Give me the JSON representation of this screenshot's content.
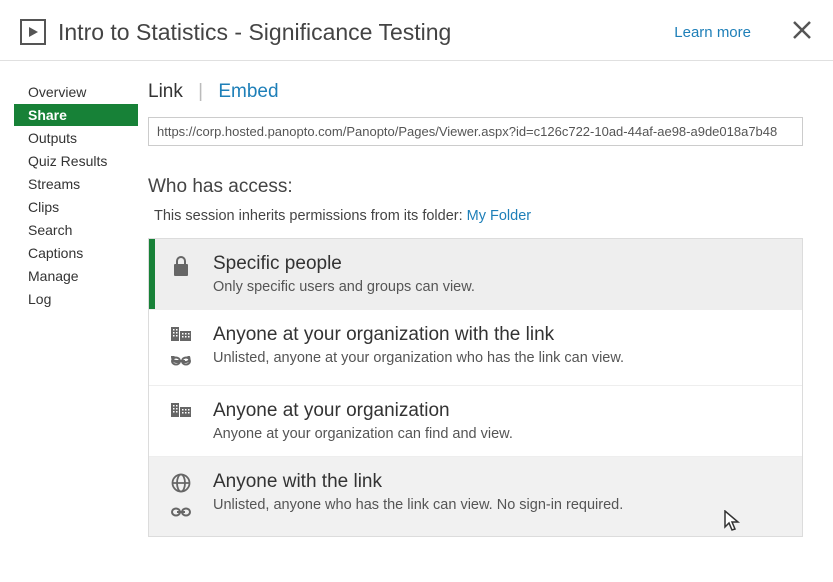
{
  "header": {
    "title": "Intro to Statistics - Significance Testing",
    "learn_more": "Learn more"
  },
  "sidebar": {
    "items": [
      {
        "label": "Overview"
      },
      {
        "label": "Share"
      },
      {
        "label": "Outputs"
      },
      {
        "label": "Quiz Results"
      },
      {
        "label": "Streams"
      },
      {
        "label": "Clips"
      },
      {
        "label": "Search"
      },
      {
        "label": "Captions"
      },
      {
        "label": "Manage"
      },
      {
        "label": "Log"
      }
    ],
    "active_index": 1
  },
  "tabs": {
    "link": "Link",
    "embed": "Embed"
  },
  "url": "https://corp.hosted.panopto.com/Panopto/Pages/Viewer.aspx?id=c126c722-10ad-44af-ae98-a9de018a7b48",
  "access": {
    "heading": "Who has access:",
    "inherit_prefix": "This session inherits permissions from its folder: ",
    "folder_name": "My Folder",
    "options": [
      {
        "title": "Specific people",
        "desc": "Only specific users and groups can view.",
        "icon": "lock"
      },
      {
        "title": "Anyone at your organization with the link",
        "desc": "Unlisted, anyone at your organization who has the link can view.",
        "icon": "org-link"
      },
      {
        "title": "Anyone at your organization",
        "desc": "Anyone at your organization can find and view.",
        "icon": "org"
      },
      {
        "title": "Anyone with the link",
        "desc": "Unlisted, anyone who has the link can view. No sign-in required.",
        "icon": "globe-link"
      }
    ],
    "selected_index": 0,
    "hover_index": 3
  }
}
